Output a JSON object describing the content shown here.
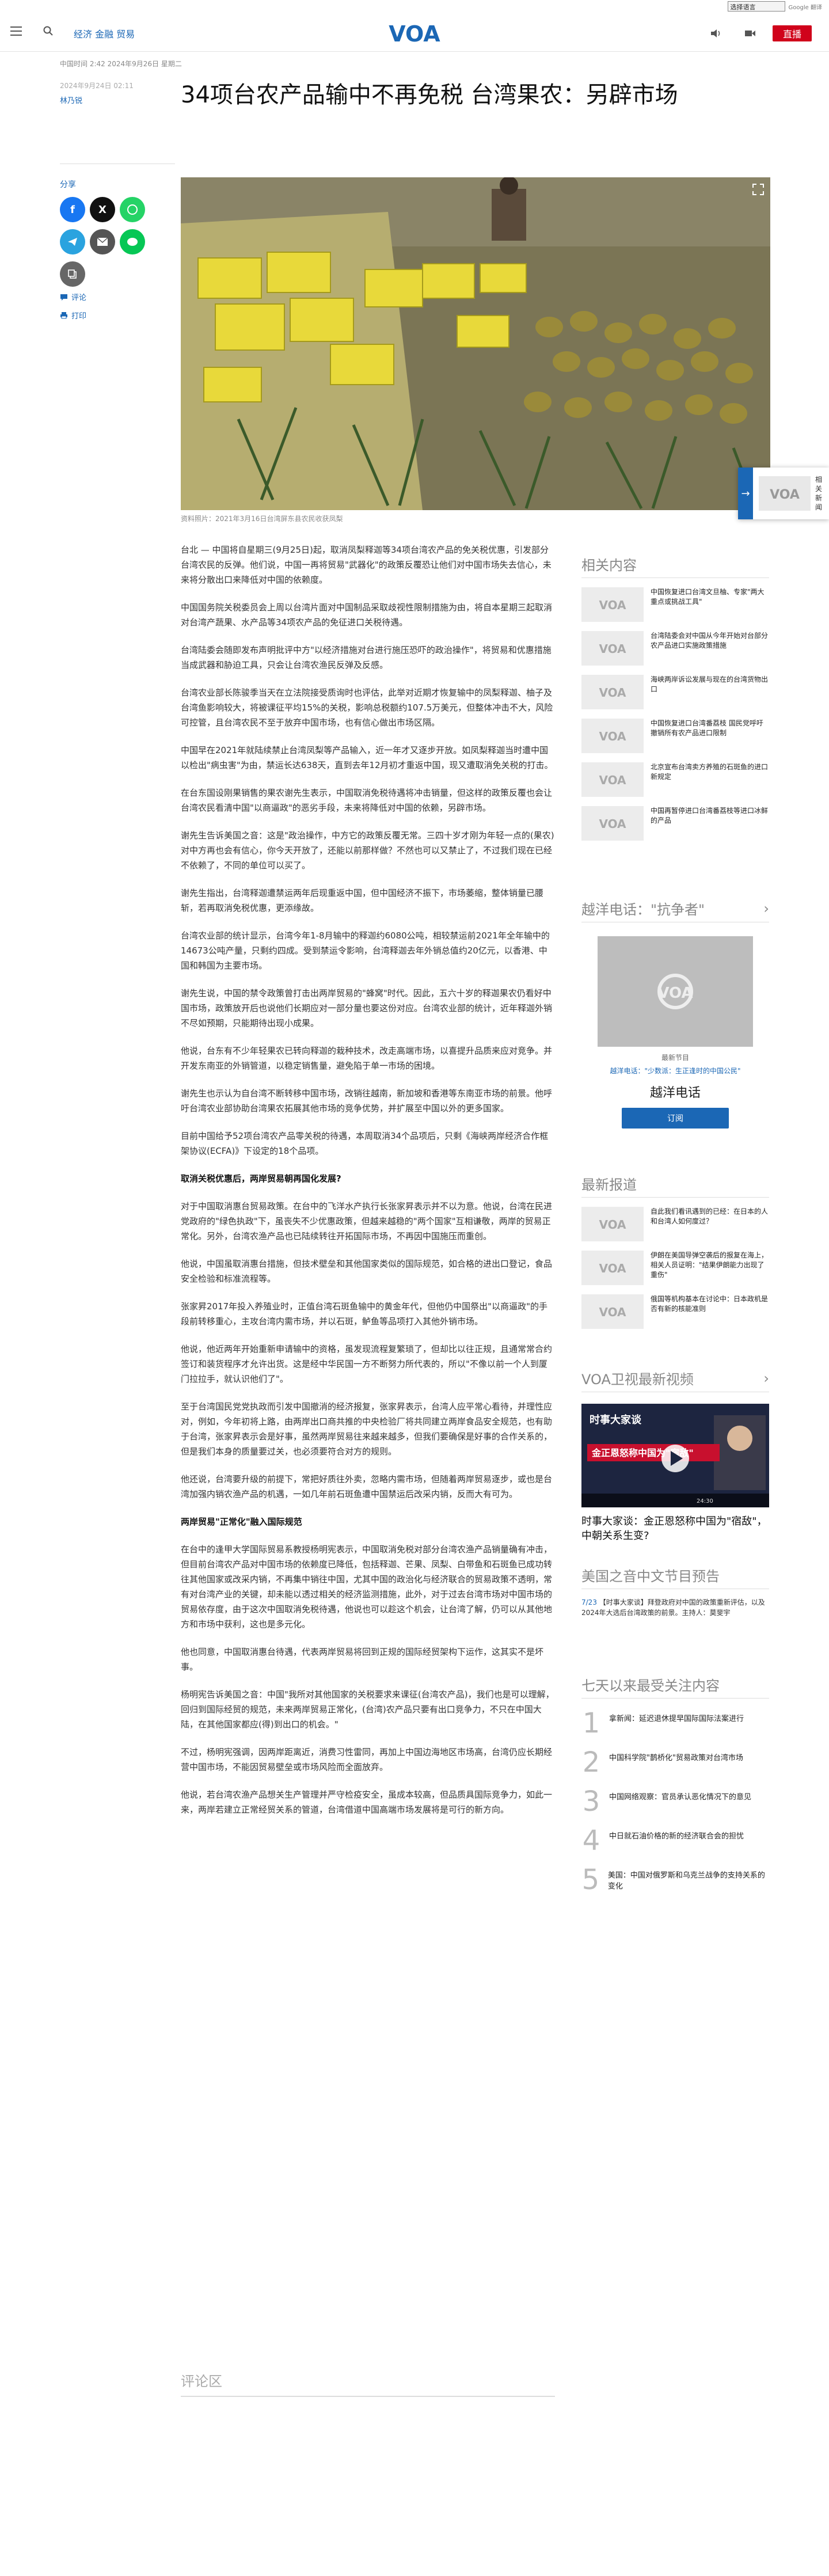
{
  "translate": {
    "select_label": "选择语言",
    "powered": "Google 翻译",
    "provider": "Powered by Google 翻译"
  },
  "header": {
    "nav": "经济 金融 贸易",
    "logo_text": "VOA",
    "live": "直播"
  },
  "meta": {
    "updated": "中国时间 2:42 2024年9月26日 星期二",
    "published": "2024年9月24日 02:11",
    "author": "林乃锐"
  },
  "headline": "34项台农产品输中不再免税 台湾果农：另辟市场",
  "share": {
    "label": "分享",
    "comment": "评论",
    "print": "打印"
  },
  "hero": {
    "caption": "资料照片：2021年3月16日台湾屏东县农民收获凤梨"
  },
  "article": {
    "paragraphs": [
      "台北 — 中国将自星期三(9月25日)起，取消凤梨释迦等34项台湾农产品的免关税优惠，引发部分台湾农民的反弹。他们说，中国一再将贸易\"武器化\"的政策反覆恐让他们对中国市场失去信心，未来将分散出口来降低对中国的依赖度。",
      "中国国务院关税委员会上周以台湾片面对中国制品采取歧视性限制措施为由，将自本星期三起取消对台湾产蔬果、水产品等34项农产品的免征进口关税待遇。",
      "台湾陆委会随即发布声明批评中方\"以经济措施对台进行施压恐吓的政治操作\"，将贸易和优惠措施当成武器和胁迫工具，只会让台湾农渔民反弹及反感。",
      "台湾农业部长陈骏季当天在立法院接受质询时也评估，此举对近期才恢复输中的凤梨释迦、柚子及台湾鱼影响较大，将被课征平均15%的关税，影响总税额约107.5万美元，但整体冲击不大，风险可控管，且台湾农民不至于放弃中国市场，也有信心做出市场区隔。",
      "中国早在2021年就陆续禁止台湾凤梨等产品输入，近一年才又逐步开放。如凤梨释迦当时遭中国以检出\"病虫害\"为由，禁运长达638天，直到去年12月初才重返中国，现又遭取消免关税的打击。",
      "在台东国设刚果销售的果农谢先生表示，中国取消免税待遇将冲击销量，但这样的政策反覆也会让台湾农民看清中国\"以商逼政\"的恶劣手段，未来将降低对中国的依赖，另辟市场。",
      "谢先生告诉美国之音：这是\"政治操作，中方它的政策反覆无常。三四十岁才刚为年轻一点的(果农)对中方再也会有信心，你今天开放了，还能以前那样做？不然也可以又禁止了，不过我们现在已经不依赖了，不同的单位可以买了。",
      "谢先生指出，台湾释迦遭禁运两年后现重返中国，但中国经济不振下，市场萎缩，整体销量已腰斩，若再取消免税优惠，更添缘故。",
      "台湾农业部的统计显示，台湾今年1-8月输中的释迦约6080公吨，相较禁运前2021年全年输中的14673公吨产量，只剩约四成。受到禁运令影响，台湾释迦去年外销总值约20亿元，以香港、中国和韩国为主要市场。",
      "谢先生说，中国的禁令政策曾打击出两岸贸易的\"蜂窝\"时代。因此，五六十岁的释迦果农仍看好中国市场，政策放开后也说他们长期应对一部分量也要这份对应。台湾农业部的统计，近年释迦外销不尽如预期，只能期待出现小成果。",
      "他说，台东有不少年轻果农已转向释迦的栽种技术，改走高端市场，以喜提升品质来应对竞争。并开发东南亚的外销管道，以稳定销售量，避免陷于单一市场的困境。",
      "谢先生也示认为自台湾不断转移中国市场，改销往越南，新加坡和香港等东南亚市场的前景。他呼吁台湾农业部协助台湾果农拓展其他市场的竞争优势，并扩展至中国以外的更多国家。",
      "目前中国给予52项台湾农产品零关税的待遇，本周取消34个品项后，只剩《海峡两岸经济合作框架协议(ECFA)》下设定的18个品项。"
    ],
    "subhead1": "取消关税优惠后，两岸贸易朝再国化发展?",
    "paragraphs2": [
      "对于中国取消惠台贸易政策。在台中的飞洋水产执行长张家昇表示并不以为意。他说，台湾在民进党政府的\"绿色执政\"下，虽丧失不少优惠政策，但越来越稳的\"两个国家\"互相谦敬，两岸的贸易正常化。另外，台湾农渔产品也已陆续转往开拓国际市场，不再因中国施压而重创。",
      "他说，中国虽取消惠台措施，但技术壁垒和其他国家类似的国际规范，如合格的进出口登记，食品安全检验和标准流程等。",
      "张家昇2017年投入养殖业时，正值台湾石斑鱼输中的黄金年代，但他仍中国祭出\"以商逼政\"的手段前转移重心，主攻台湾内需市场，并以石斑，鲈鱼等品项打入其他外销市场。",
      "他说，他近两年开始重新申请输中的资格，虽发现流程复繁琐了，但却比以往正规，且通常常合约签订和装货程序才允许出货。这是经中华民国一方不断努力所代表的，所以\"不像以前一个人到厦门拉拉手，就认识他们了\"。",
      "至于台湾国民党党执政而引发中国撤消的经济报复，张家昇表示，台湾人应平常心看待，并理性应对，例如，今年初将上路，由两岸出口商共推的中央检验厂将共同建立两岸食品安全规范，也有助于台湾，张家昇表示会是好事，虽然两岸贸易往来越来越多，但我们要确保是好事的合作关系的，但是我们本身的质量要过关，也必须要符合对方的规则。",
      "他还说，台湾要升级的前提下，常把好质往外卖，忽略内需市场，但随着两岸贸易逐步，或也是台湾加强内销农渔产品的机遇，一如几年前石斑鱼遭中国禁运后改采内销，反而大有可为。"
    ],
    "subhead2": "两岸贸易\"正常化\"融入国际规范",
    "paragraphs3": [
      "在台中的逢甲大学国际贸易系教授杨明宪表示，中国取消免税对部分台湾农渔产品销量确有冲击，但目前台湾农产品对中国市场的依赖度已降低，包括释迦、芒果、凤梨、白带鱼和石斑鱼已成功转往其他国家或改采内销，不再集中销往中国，尤其中国的政治化与经济联合的贸易政策不透明，常有对台湾产业的关键，却未能以透过相关的经济监测措施，此外，对于过去台湾市场对中国市场的贸易依存度，由于这次中国取消免税待遇，他说也可以趁这个机会，让台湾了解，仍可以从其他地方和市场中获利，这也是多元化。",
      "他也同意，中国取消惠台待遇，代表两岸贸易将回到正规的国际经贸架构下运作，这其实不是坏事。",
      "杨明宪告诉美国之音：中国\"我所对其他国家的关税要求来课征(台湾农产品)，我们也是可以理解，回归到国际经贸的规范，未来两岸贸易正常化，(台湾)农产品只要有出口竞争力，不只在中国大陆，在其他国家都应(得)到出口的机会。\"",
      "不过，杨明宪强调，因两岸距离近，消费习性雷同，再加上中国边海地区市场高，台湾仍应长期经营中国市场，不能因贸易壁垒或市场风险而全面放弃。",
      "他说，若台湾农渔产品想关生产管理并严守检疫安全，虽成本较高，但品质具国际竞争力，如此一来，两岸若建立正常经贸关系的管道，台湾借道中国高端市场发展将是可行的新方向。"
    ]
  },
  "comments": {
    "title": "评论区"
  },
  "related": {
    "title": "相关内容",
    "items": [
      "中国恢复进口台湾文旦柚、专家\"两大重点或挑战工具\"",
      "台湾陆委会对中国从今年开始对台部分农产品进口实施政策措施",
      "海峡两岸诉讼发展与现在的台湾货物出口",
      "中国恢复进口台湾番荔枝 国民党呼吁撤销所有农产品进口限制",
      "北京宣布台湾卖方养殖的石斑鱼的进口新规定",
      "中国再暂停进口台湾番荔枝等进口冰鲜的产品"
    ]
  },
  "program": {
    "title": "越洋电话：\"抗争者\"",
    "label": "最新节目",
    "link": "越洋电话：\"少数派：生正逢时的中国公民\"",
    "name": "越洋电话",
    "subscribe": "订阅"
  },
  "latest": {
    "title": "最新报道",
    "items": [
      "自此我们看讯遇到的已经：在日本的人和台湾人如何度过？",
      "伊朗在美国导弹空袭后的报复在海上，相关人员证明：\"结果伊朗能力出现了重伤\"",
      "俄国等机构基本在讨论中：日本政机是否有新的核能准则"
    ]
  },
  "video": {
    "title": "VOA卫视最新视频",
    "caption": "时事大家谈：金正恩怒称中国为\"宿敌\"，中朝关系生变?",
    "overlay_top": "时事大家谈",
    "overlay": "金正恩怒称中国为\"宿敌\"",
    "time": "24:30"
  },
  "radio": {
    "title": "美国之音中文节目预告",
    "date": "7/23",
    "text": "【时事大家谈】拜登政府对中国的政策重新评估，以及2024年大选后台湾政策的前景。主持人：莫斐宇"
  },
  "ranking": {
    "title": "七天以来最受关注内容",
    "items": [
      "拿新闻：延迟退休提早国际国际法案进行",
      "中国科学院\"鹊桥化\"贸易政策对台湾市场",
      "中国网络观察：官员承认恶化情况下的意见",
      "中日就石油价格的新的经济联合会的担忧",
      "美国：中国对俄罗斯和乌克兰战争的支持关系的变化"
    ]
  },
  "float": {
    "text": "相关新闻"
  }
}
